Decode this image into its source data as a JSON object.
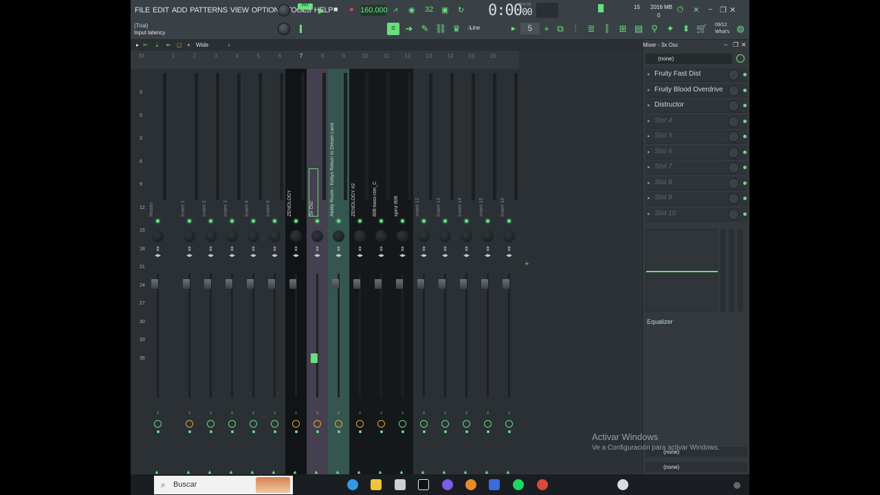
{
  "menu": [
    "FILE",
    "EDIT",
    "ADD",
    "PATTERNS",
    "VIEW",
    "OPTIONS",
    "TOOLS",
    "HELP"
  ],
  "transport": {
    "pat_label": "PAT",
    "song_label": "SONG",
    "tempo": "160.000",
    "time": "0:00",
    "time_sub": "00",
    "time_unit": "M:S:CS"
  },
  "cpu": {
    "voices": "15",
    "memory": "2016 MB",
    "cpu": "0"
  },
  "hint": {
    "title": "(Trial)",
    "text": "Input latency"
  },
  "snap": {
    "label": "Line",
    "step": "5"
  },
  "news": {
    "date": "09/12",
    "label": "What's"
  },
  "mixer_header": {
    "view": "Wide"
  },
  "track_numbers": [
    "M",
    "1",
    "2",
    "3",
    "4",
    "5",
    "6",
    "7",
    "8",
    "9",
    "10",
    "11",
    "12",
    "13",
    "14",
    "15",
    "16"
  ],
  "scale": [
    "3",
    "0",
    "3",
    "6",
    "9",
    "12",
    "15",
    "18",
    "21",
    "24",
    "27",
    "30",
    "33",
    "36"
  ],
  "strips": [
    {
      "name": "Master",
      "mute": "green"
    },
    {
      "name": "Insert 1",
      "mute": "orange"
    },
    {
      "name": "Insert 2",
      "mute": "green"
    },
    {
      "name": "Insert 3",
      "mute": "green"
    },
    {
      "name": "Insert 4",
      "mute": "green"
    },
    {
      "name": "Insert 5",
      "mute": "green"
    },
    {
      "name": "ZENOLOGY",
      "mute": "orange"
    },
    {
      "name": "3x Osc",
      "mute": "orange"
    },
    {
      "name": "Ability Room - Kirbys Return to Dream Land",
      "mute": "orange"
    },
    {
      "name": "ZENOLOGY #2",
      "mute": "orange"
    },
    {
      "name": "808-bass-ctm_C",
      "mute": "orange"
    },
    {
      "name": "spinz 808",
      "mute": "green"
    },
    {
      "name": "Insert 12",
      "mute": "green"
    },
    {
      "name": "Insert 13",
      "mute": "green"
    },
    {
      "name": "Insert 14",
      "mute": "green"
    },
    {
      "name": "Insert 15",
      "mute": "green"
    },
    {
      "name": "Insert 16",
      "mute": "green"
    }
  ],
  "fx_panel": {
    "title": "Mixer - 3x Osc",
    "input": "(none)",
    "slots": [
      "Fruity Fast Dist",
      "Fruity Blood Overdrive",
      "Distructor",
      "Slot 4",
      "Slot 5",
      "Slot 6",
      "Slot 7",
      "Slot 8",
      "Slot 9",
      "Slot 10"
    ],
    "equalizer_label": "Equalizer",
    "output_top": "(none)",
    "output_bottom": "(none)"
  },
  "watermark": {
    "line1": "Activar Windows",
    "line2": "Ve a Configuración para activar Windows."
  },
  "taskbar": {
    "search_placeholder": "Buscar"
  },
  "colors": {
    "accent": "#69e07e",
    "orange": "#e7a83a",
    "background": "#2c3236"
  }
}
